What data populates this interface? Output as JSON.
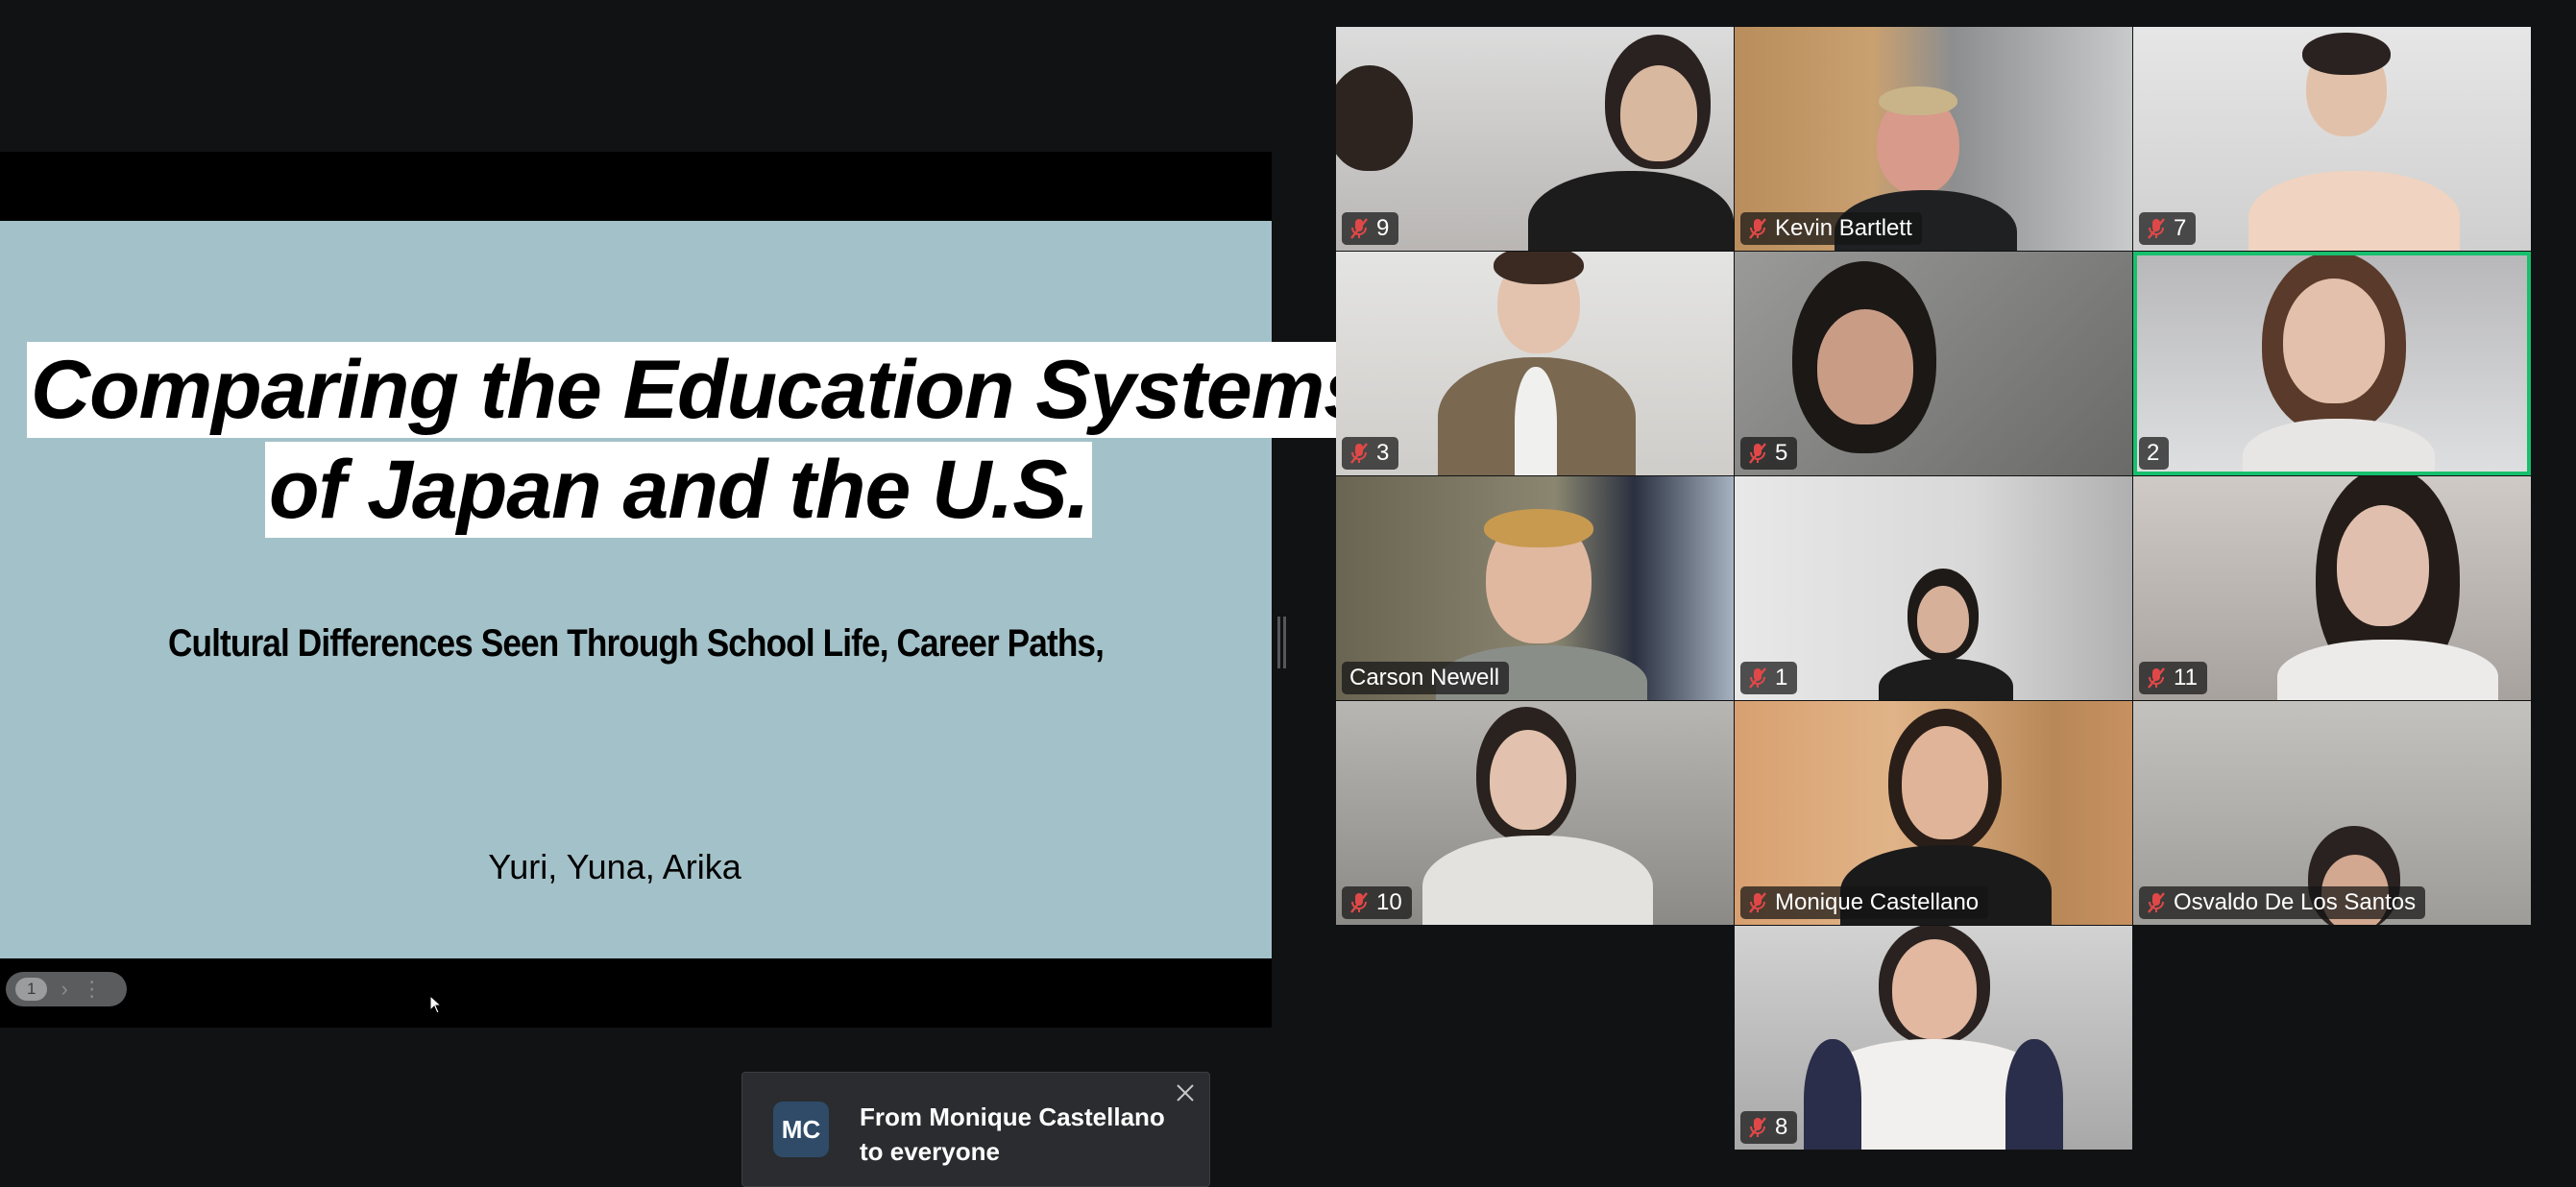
{
  "shared_screen": {
    "slide": {
      "title_line_1": "Comparing the Education Systems",
      "title_line_2": "of Japan and the U.S.",
      "subtitle": "Cultural Differences Seen Through School Life, Career Paths,",
      "authors": "Yuri, Yuna, Arika",
      "background_color": "#a3c1c8"
    },
    "toolbar": {
      "page_number": "1",
      "next_icon": "chevron-right-icon",
      "more_icon": "more-vertical-icon"
    }
  },
  "gallery": {
    "tiles": [
      {
        "label": "9",
        "muted": true,
        "active": false
      },
      {
        "label": "Kevin Bartlett",
        "muted": true,
        "active": false
      },
      {
        "label": "7",
        "muted": true,
        "active": false
      },
      {
        "label": "3",
        "muted": true,
        "active": false
      },
      {
        "label": "5",
        "muted": true,
        "active": false
      },
      {
        "label": "2",
        "muted": false,
        "active": true
      },
      {
        "label": "Carson Newell",
        "muted": false,
        "active": false
      },
      {
        "label": "1",
        "muted": true,
        "active": false
      },
      {
        "label": "11",
        "muted": true,
        "active": false
      },
      {
        "label": "10",
        "muted": true,
        "active": false
      },
      {
        "label": "Monique Castellano",
        "muted": true,
        "active": false
      },
      {
        "label": "Osvaldo De Los Santos",
        "muted": true,
        "active": false
      },
      {
        "label": "8",
        "muted": true,
        "active": false
      }
    ],
    "active_speaker_color": "#18c06d",
    "mute_icon_color": "#e04848"
  },
  "chat_notification": {
    "avatar_initials": "MC",
    "message": "From Monique Castellano to everyone",
    "close_icon": "close-icon"
  }
}
